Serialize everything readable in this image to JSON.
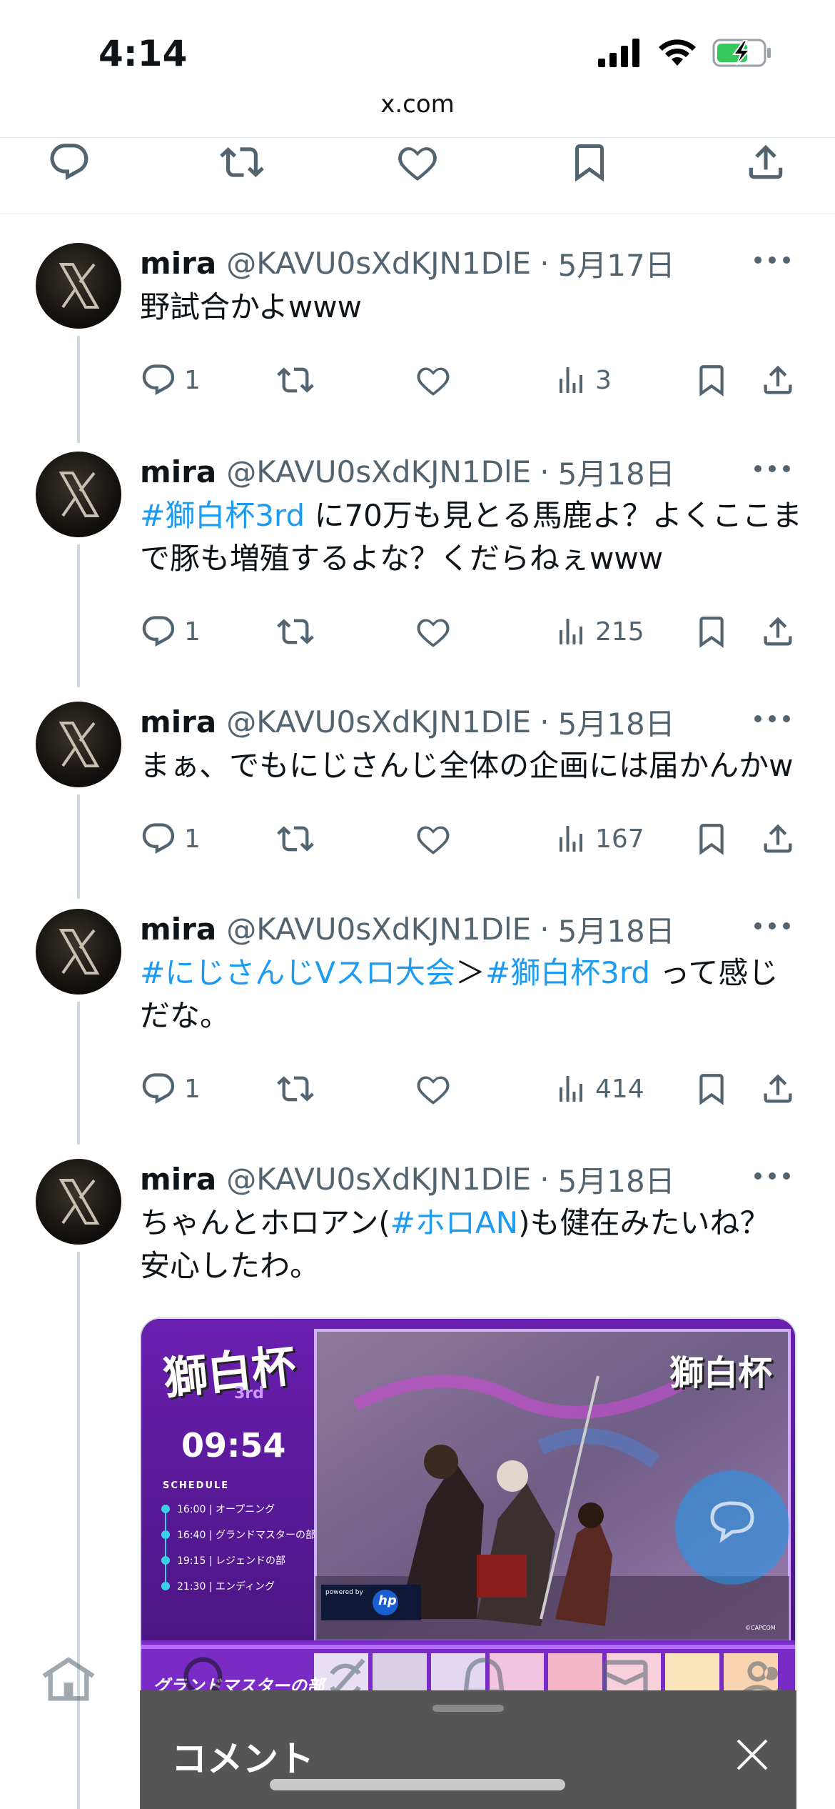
{
  "status_bar": {
    "time": "4:14"
  },
  "browser": {
    "url": "x.com"
  },
  "tweets": [
    {
      "name": "mira",
      "handle": "@KAVU0sXdKJN1DlE",
      "date": "5月17日",
      "text_parts": [
        "野試合かよwww"
      ],
      "replies": "1",
      "views": "3"
    },
    {
      "name": "mira",
      "handle": "@KAVU0sXdKJN1DlE",
      "date": "5月18日",
      "hashtag1": "#獅白杯3rd",
      "text_line1_rest": " に70万も見とる馬鹿よ？よくここま",
      "text_line2": "で豚も増殖するよな？くだらねぇwww",
      "replies": "1",
      "views": "215"
    },
    {
      "name": "mira",
      "handle": "@KAVU0sXdKJN1DlE",
      "date": "5月18日",
      "text_line1": "まぁ、でもにじさんじ全体の企画には届かんかw",
      "replies": "1",
      "views": "167"
    },
    {
      "name": "mira",
      "handle": "@KAVU0sXdKJN1DlE",
      "date": "5月18日",
      "hashtag1": "#にじさんじVスロ大会",
      "separator": "＞",
      "hashtag2": "#獅白杯3rd",
      "text_line1_rest": " って感じ",
      "text_line2": "だな。",
      "replies": "1",
      "views": "414"
    },
    {
      "name": "mira",
      "handle": "@KAVU0sXdKJN1DlE",
      "date": "5月18日",
      "text_line1_a": "ちゃんとホロアン(",
      "hashtag1": "#ホロAN",
      "text_line1_b": ")も健在みたいね？",
      "text_line2": "安心したわ。"
    }
  ],
  "media": {
    "logo_text": "獅白杯",
    "logo_sub": "3rd",
    "clock": "09:54",
    "schedule_label": "SCHEDULE",
    "schedule": [
      {
        "time": "16:00",
        "item": "オープニング"
      },
      {
        "time": "16:40",
        "item": "グランドマスターの部"
      },
      {
        "time": "19:15",
        "item": "レジェンドの部"
      },
      {
        "time": "21:30",
        "item": "エンディング"
      }
    ],
    "powered_by": "powered by",
    "sponsor": "hp",
    "bottom_banner": "グランドマスターの部",
    "copyright": "©CAPCOM"
  },
  "comment_sheet": {
    "title": "コメント"
  },
  "colors": {
    "link": "#1d9bf0",
    "secondary_text": "#536471",
    "sheet": "#555555"
  }
}
